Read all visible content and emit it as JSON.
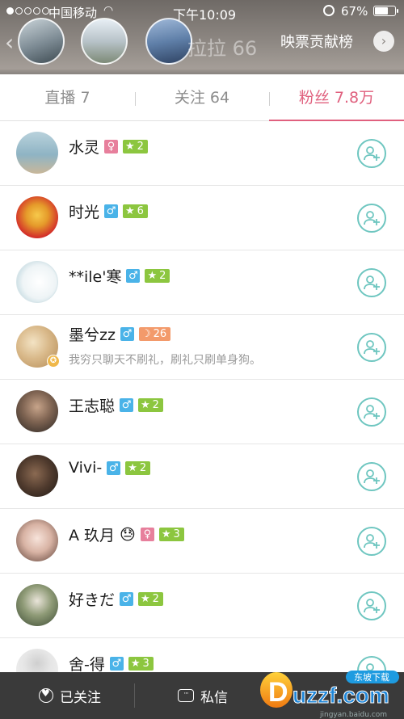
{
  "status_bar": {
    "carrier": "中国移动",
    "time": "下午10:09",
    "battery": "67%",
    "battery_level": 0.67
  },
  "header": {
    "ghost_title": "拉拉 66",
    "contribution_link": "映票贡献榜"
  },
  "tabs": [
    {
      "label": "直播 7",
      "active": false
    },
    {
      "label": "关注 64",
      "active": false
    },
    {
      "label": "粉丝 7.8万",
      "active": true
    }
  ],
  "fans": [
    {
      "name": "水灵",
      "gender": "♀",
      "level": "2",
      "level_type": "star"
    },
    {
      "name": "时光",
      "gender": "♂",
      "level": "6",
      "level_type": "star"
    },
    {
      "name": "**ile'寒",
      "gender": "♂",
      "level": "2",
      "level_type": "star"
    },
    {
      "name": "墨兮zz",
      "gender": "♂",
      "level": "26",
      "level_type": "moon",
      "signature": "我穷只聊天不刷礼，刷礼只刷单身狗。"
    },
    {
      "name": "王志聪",
      "gender": "♂",
      "level": "2",
      "level_type": "star"
    },
    {
      "name": "Vivi-",
      "gender": "♂",
      "level": "2",
      "level_type": "star"
    },
    {
      "name": "A 玖月",
      "emoji": "😓",
      "gender": "♀",
      "level": "3",
      "level_type": "star"
    },
    {
      "name": "好きだ",
      "gender": "♂",
      "level": "2",
      "level_type": "star"
    },
    {
      "name": "舍-得",
      "gender": "♂",
      "level": "3",
      "level_type": "star"
    }
  ],
  "bottom_bar": {
    "follow_label": "已关注",
    "message_label": "私信"
  },
  "watermark": {
    "logo_text": "uzzf.com",
    "logo_sub": "东坡下载",
    "url": "jingyan.baidu.com"
  },
  "colors": {
    "accent_pink": "#e0607e",
    "follow_teal": "#6ec6c0",
    "male_blue": "#4ab3e8",
    "female_pink": "#e77f9c",
    "level_green": "#8cc63f",
    "level_orange": "#f39a6b"
  }
}
